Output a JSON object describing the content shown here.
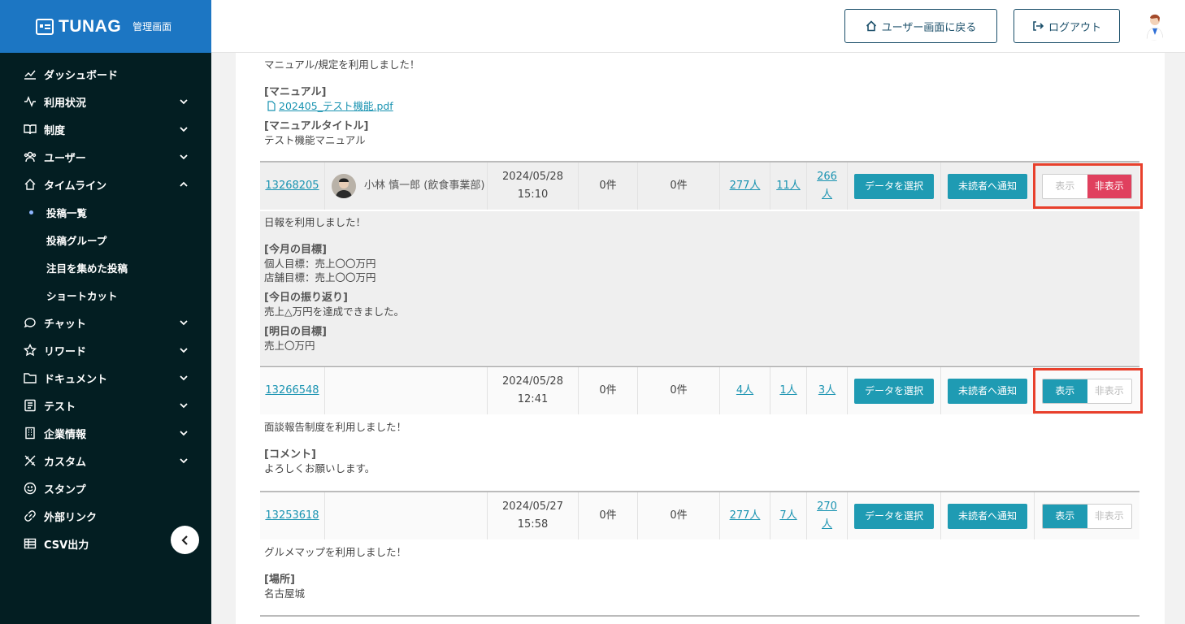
{
  "brand": {
    "name": "TUNAG",
    "subtitle": "管理画面"
  },
  "nav": {
    "items": [
      {
        "label": "ダッシュボード",
        "icon": "chart-line-icon",
        "chevron": ""
      },
      {
        "label": "利用状況",
        "icon": "pulse-icon",
        "chevron": "down"
      },
      {
        "label": "制度",
        "icon": "book-icon",
        "chevron": "down"
      },
      {
        "label": "ユーザー",
        "icon": "users-icon",
        "chevron": "down"
      },
      {
        "label": "タイムライン",
        "icon": "home-icon",
        "chevron": "up"
      }
    ],
    "sub_items": [
      {
        "label": "投稿一覧",
        "active": true
      },
      {
        "label": "投稿グループ",
        "active": false
      },
      {
        "label": "注目を集めた投稿",
        "active": false
      },
      {
        "label": "ショートカット",
        "active": false
      }
    ],
    "items_after": [
      {
        "label": "チャット",
        "icon": "chat-icon",
        "chevron": "down"
      },
      {
        "label": "リワード",
        "icon": "star-icon",
        "chevron": "down"
      },
      {
        "label": "ドキュメント",
        "icon": "folder-icon",
        "chevron": "down"
      },
      {
        "label": "テスト",
        "icon": "test-icon",
        "chevron": "down"
      },
      {
        "label": "企業情報",
        "icon": "building-icon",
        "chevron": "down"
      },
      {
        "label": "カスタム",
        "icon": "tools-icon",
        "chevron": "down"
      },
      {
        "label": "スタンプ",
        "icon": "smile-icon",
        "chevron": ""
      },
      {
        "label": "外部リンク",
        "icon": "link-icon",
        "chevron": ""
      },
      {
        "label": "CSV出力",
        "icon": "table-icon",
        "chevron": ""
      }
    ]
  },
  "header": {
    "user_screen_button": "ユーザー画面に戻る",
    "logout_button": "ログアウト"
  },
  "buttons": {
    "select_data": "データを選択",
    "notify_unread": "未読者へ通知",
    "show": "表示",
    "hide": "非表示"
  },
  "top_block": {
    "intro": "マニュアル/規定を利用しました！",
    "manual_label": "[マニュアル]",
    "manual_file": "202405_テスト機能.pdf",
    "manual_title_label": "[マニュアルタイトル]",
    "manual_title": "テスト機能マニュアル"
  },
  "rows": [
    {
      "id": "13268205",
      "user": "小林 慎一郎 (飲食事業部)",
      "date": "2024/05/28",
      "time": "15:10",
      "count1": "0件",
      "count2": "0件",
      "r1": "277人",
      "r2": "11人",
      "r3": "266人",
      "visibility": "hidden",
      "body": {
        "intro": "日報を利用しました！",
        "sections": [
          {
            "label": "[今月の目標]",
            "lines": [
              "個人目標：売上〇〇万円",
              "店舗目標：売上〇〇万円"
            ]
          },
          {
            "label": "[今日の振り返り]",
            "lines": [
              "売上△万円を達成できました。"
            ]
          },
          {
            "label": "[明日の目標]",
            "lines": [
              "売上〇万円"
            ]
          }
        ]
      }
    },
    {
      "id": "13266548",
      "user": "",
      "date": "2024/05/28",
      "time": "12:41",
      "count1": "0件",
      "count2": "0件",
      "r1": "4人",
      "r2": "1人",
      "r3": "3人",
      "visibility": "shown",
      "body": {
        "intro": "面談報告制度を利用しました！",
        "sections": [
          {
            "label": "[コメント]",
            "lines": [
              "よろしくお願いします。"
            ]
          }
        ]
      }
    },
    {
      "id": "13253618",
      "user": "",
      "date": "2024/05/27",
      "time": "15:58",
      "count1": "0件",
      "count2": "0件",
      "r1": "277人",
      "r2": "7人",
      "r3": "270人",
      "visibility": "shown",
      "body": {
        "intro": "グルメマップを利用しました！",
        "sections": [
          {
            "label": "[場所]",
            "lines": [
              "名古屋城"
            ]
          }
        ]
      }
    }
  ],
  "colors": {
    "sidebar_bg": "#031e22",
    "brand_bg": "#1c76c3",
    "accent": "#1f9bb3",
    "hide_active": "#e0405e",
    "highlight_box": "#e8402c"
  }
}
